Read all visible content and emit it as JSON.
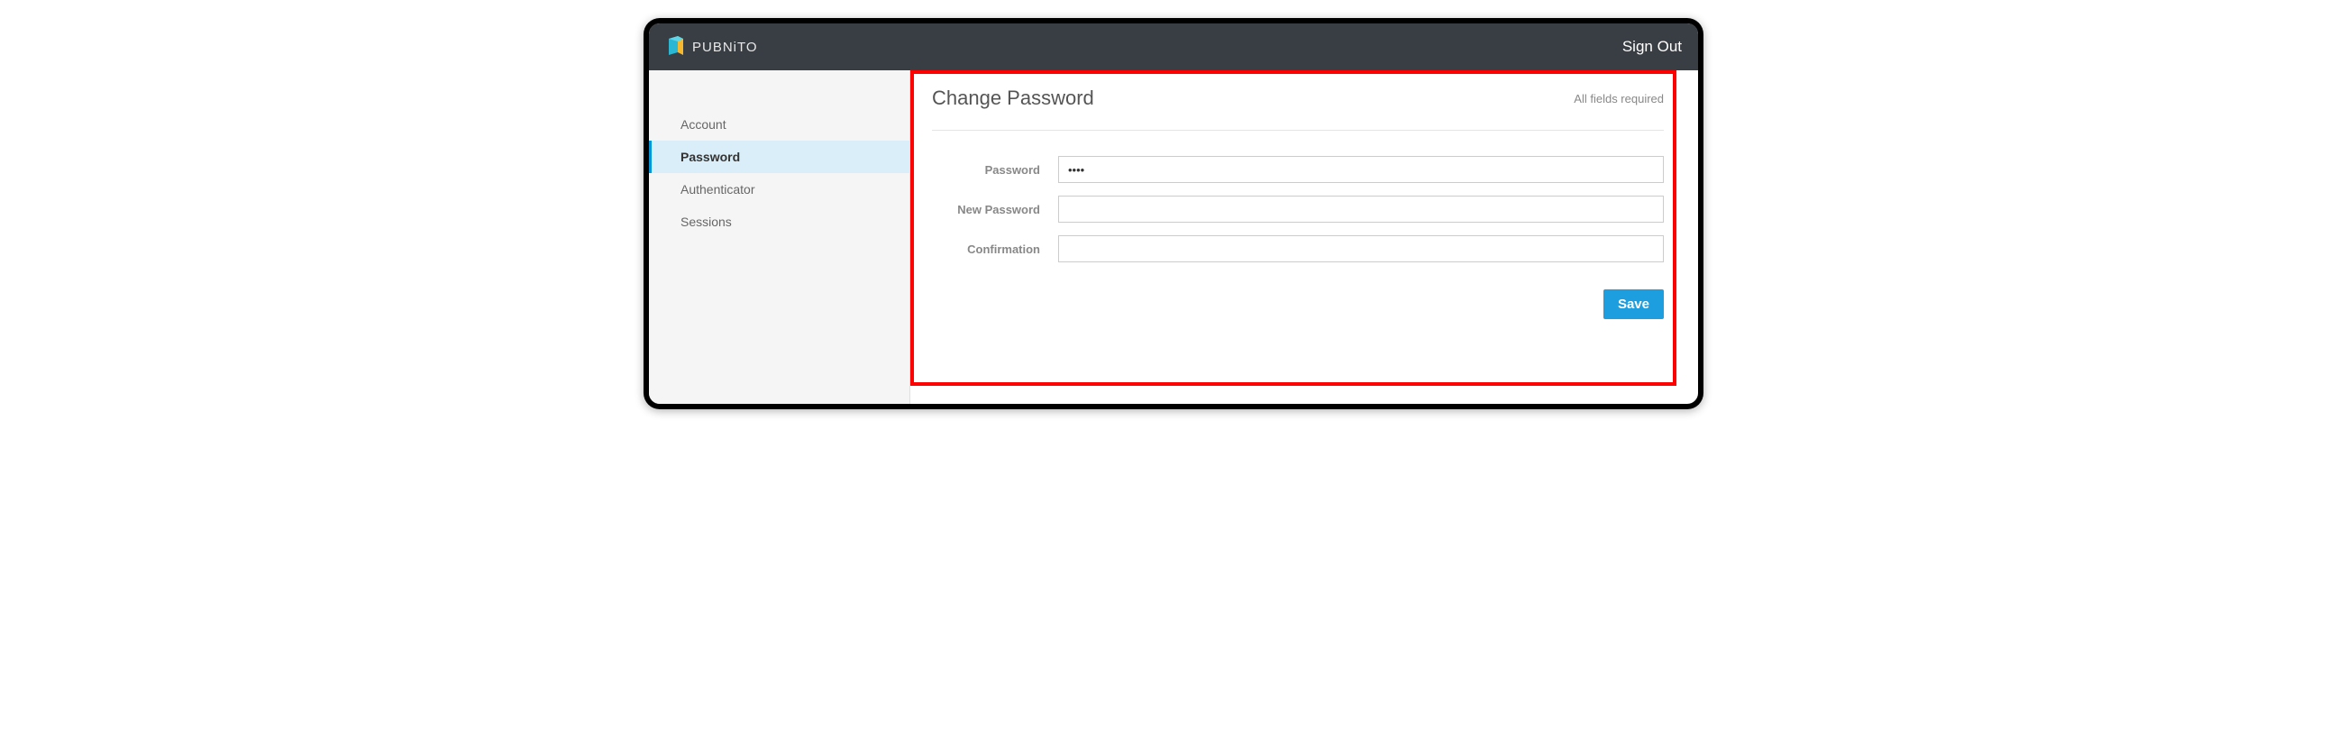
{
  "header": {
    "brand": "PUBNiTO",
    "sign_out": "Sign Out"
  },
  "sidebar": {
    "items": [
      {
        "label": "Account",
        "active": false
      },
      {
        "label": "Password",
        "active": true
      },
      {
        "label": "Authenticator",
        "active": false
      },
      {
        "label": "Sessions",
        "active": false
      }
    ]
  },
  "main": {
    "title": "Change Password",
    "required_note": "All fields required",
    "fields": {
      "password": {
        "label": "Password",
        "value": "••••"
      },
      "new_password": {
        "label": "New Password",
        "value": ""
      },
      "confirmation": {
        "label": "Confirmation",
        "value": ""
      }
    },
    "save_label": "Save"
  }
}
